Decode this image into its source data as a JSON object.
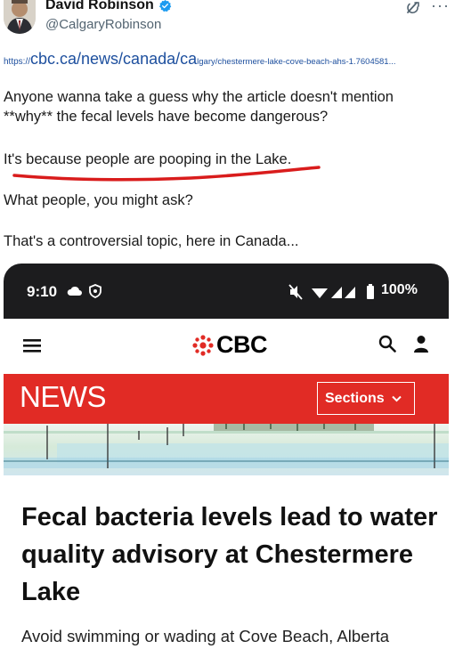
{
  "tweet": {
    "author": {
      "display_name": "David Robinson",
      "handle": "@CalgaryRobinson",
      "verified": true,
      "avatar_icon": "person-photo-avatar",
      "verified_icon": "verified-badge-icon",
      "verified_color": "#1d9bf0"
    },
    "menu": {
      "grok_icon": "grok-icon",
      "more_glyph": "···"
    },
    "link": {
      "scheme": "https://",
      "host": "cbc.ca/news/canada/ca",
      "path": "lgary/chestermere-lake-cove-beach-ahs-1.7604581..."
    },
    "paragraphs": [
      {
        "line1": "Anyone wanna take a guess why the article doesn't mention",
        "line2": "**why** the fecal levels have become dangerous?"
      },
      {
        "line1": "It's because people are pooping in the Lake."
      },
      {
        "line1": "What people, you might ask?"
      },
      {
        "line1": "That's a controversial topic, here in Canada..."
      }
    ],
    "highlight_color": "#d91c1c"
  },
  "embedded_screenshot": {
    "status_bar": {
      "time": "9:10",
      "battery": "100%",
      "icons": [
        "cloud-icon",
        "shield-icon",
        "mute-icon",
        "wifi-icon",
        "signal-icon",
        "battery-icon"
      ]
    },
    "cbc_header": {
      "logo_text": "CBC",
      "menu_icon": "hamburger-menu-icon",
      "search_icon": "search-icon",
      "account_icon": "user-icon",
      "brand_color": "#e12b25"
    },
    "news_bar": {
      "title": "NEWS",
      "sections_label": "Sections"
    },
    "article": {
      "headline": "Fecal bacteria levels lead to water quality advisory at Chestermere Lake",
      "subheadline": "Avoid swimming or wading at Cove Beach, Alberta"
    }
  }
}
